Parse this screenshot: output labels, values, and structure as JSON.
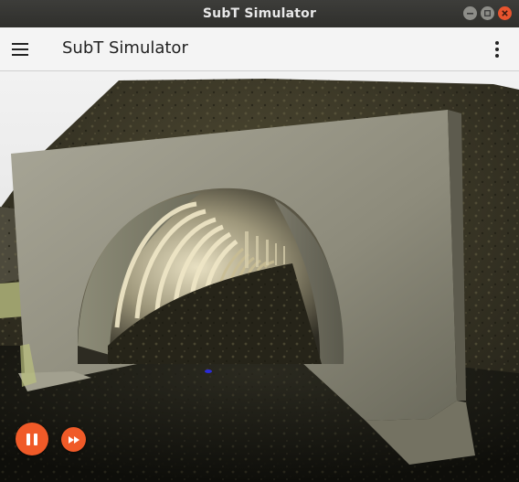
{
  "window": {
    "title": "SubT Simulator",
    "controls": [
      "minimize-icon",
      "maximize-icon",
      "close-icon"
    ]
  },
  "appbar": {
    "title": "SubT Simulator",
    "menu_icon": "hamburger-menu-icon",
    "more_icon": "more-vert-icon"
  },
  "scene": {
    "description_icon": "3d-viewport",
    "accent_color": "#f05a28"
  },
  "playback": {
    "play_pause_icon": "pause-icon",
    "step_icon": "fast-forward-icon"
  }
}
